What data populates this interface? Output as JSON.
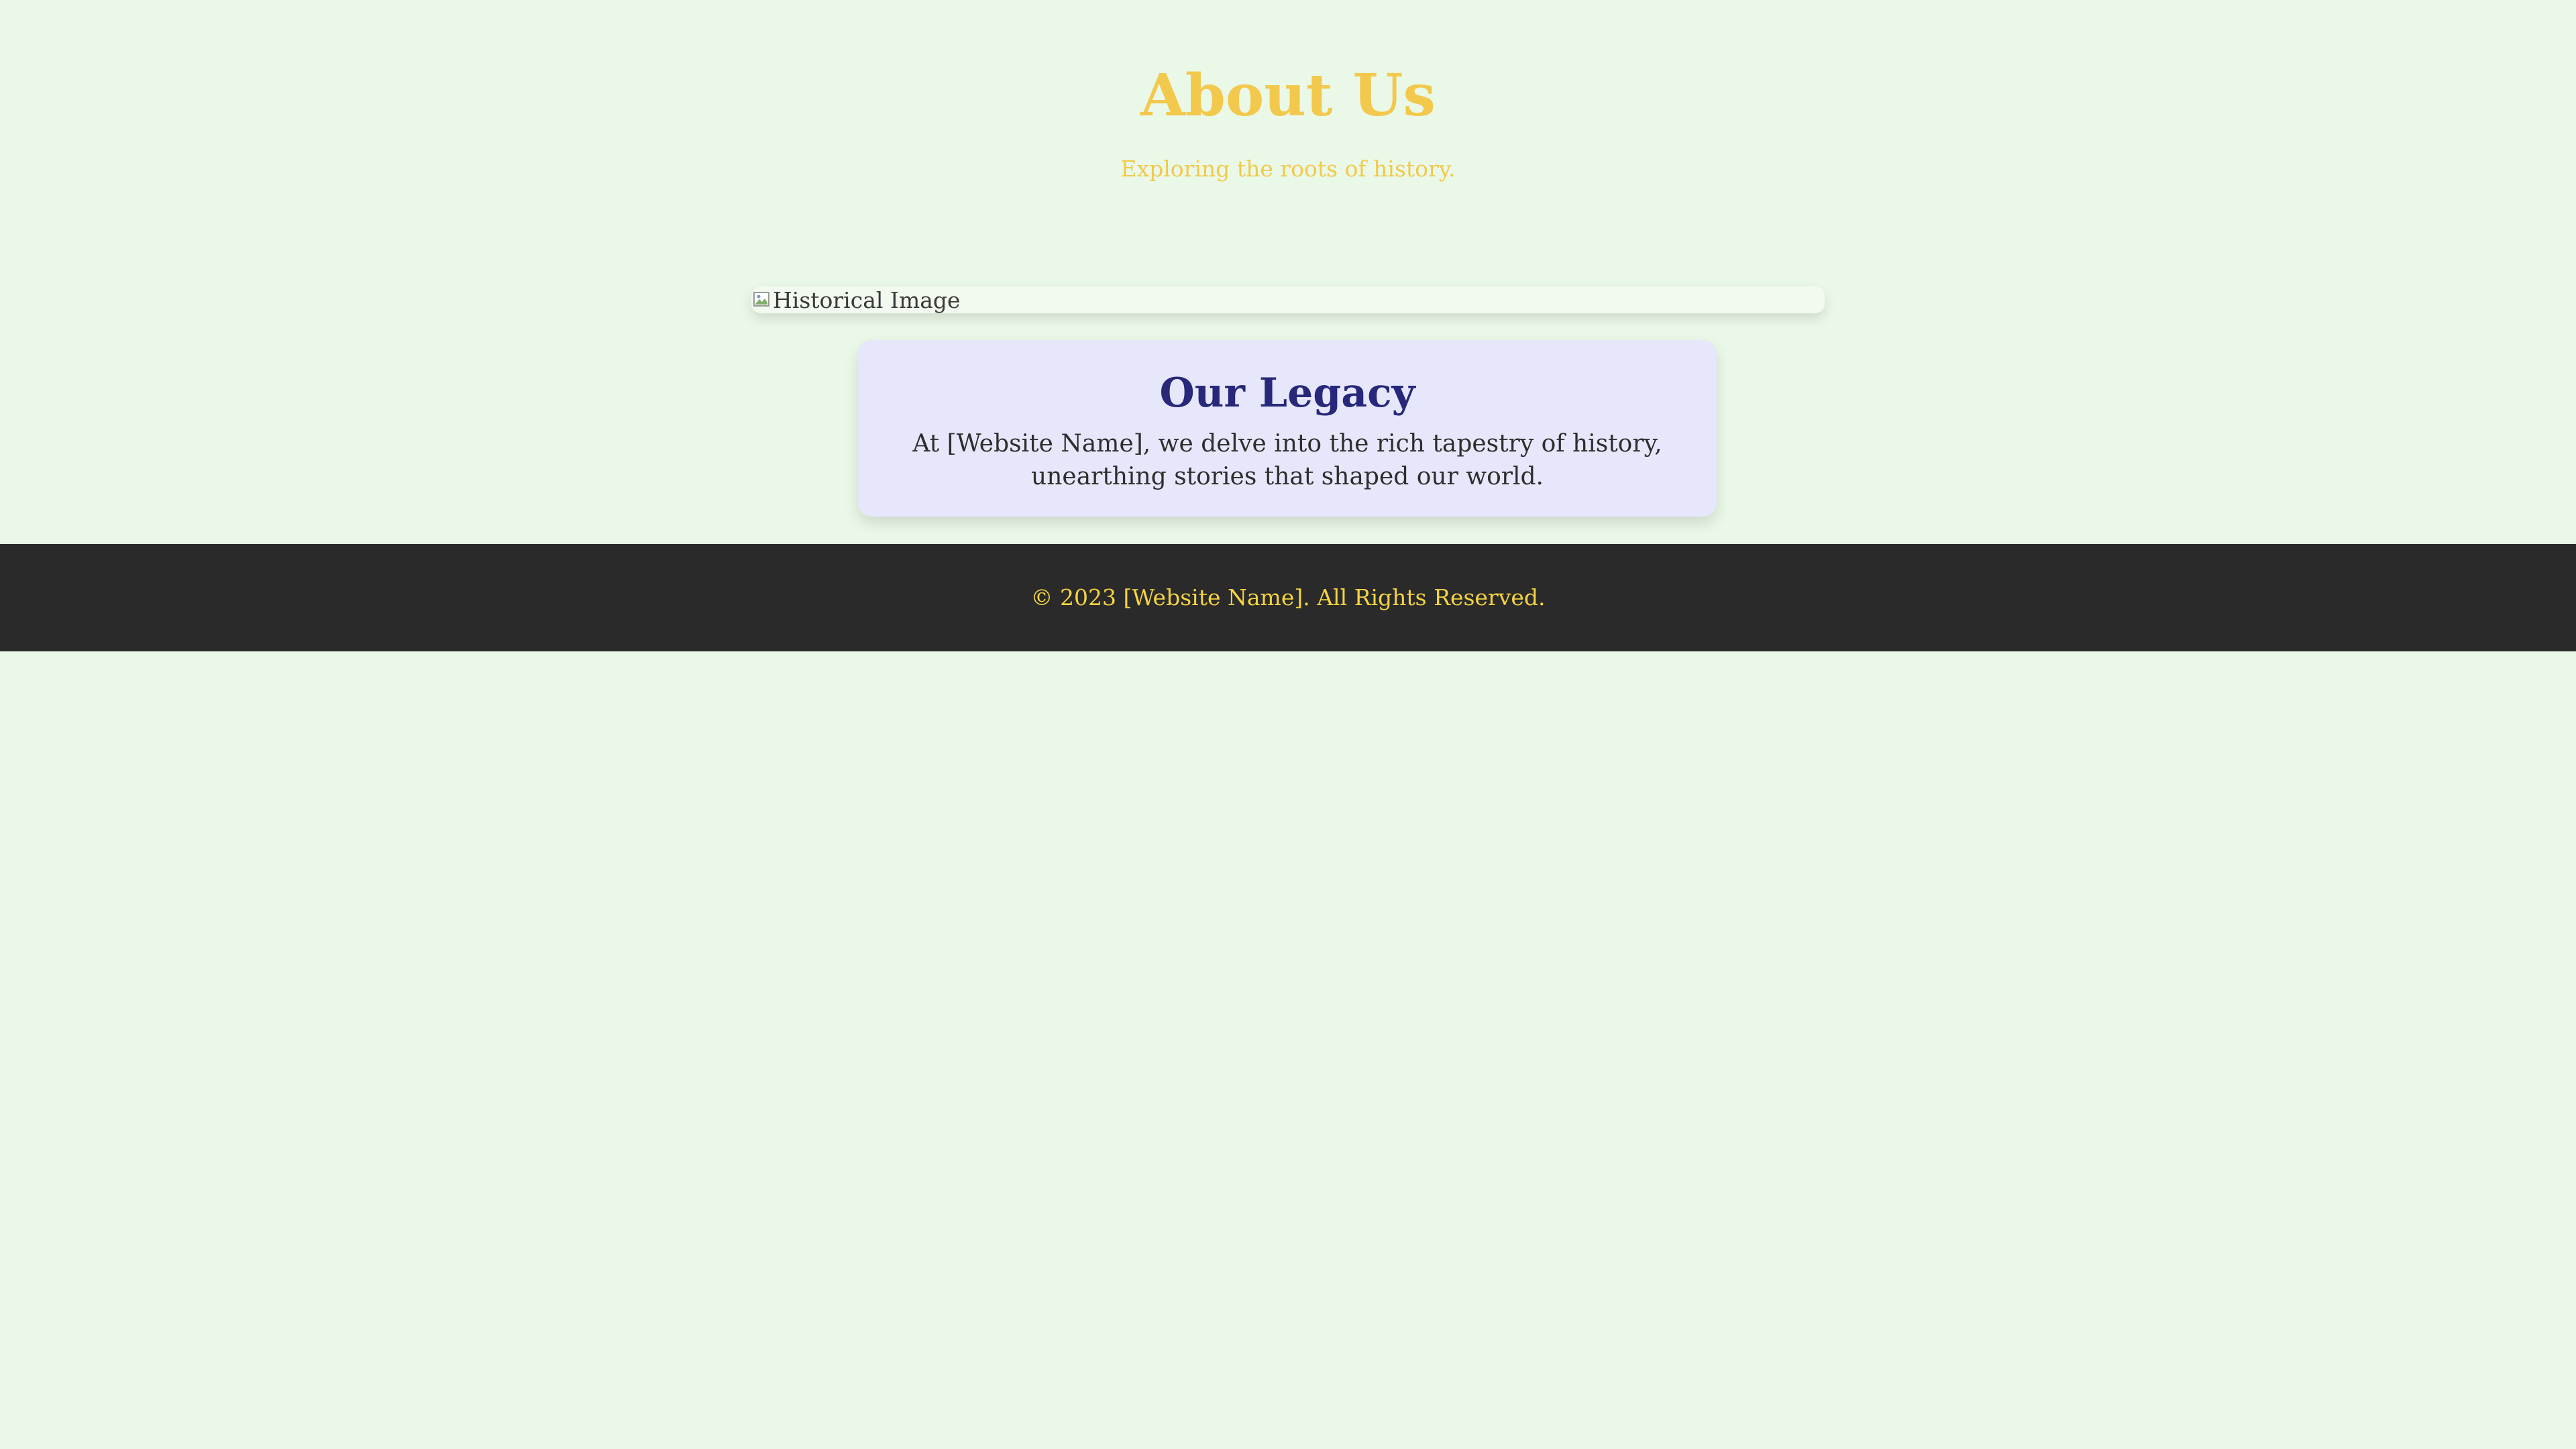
{
  "header": {
    "title": "About Us",
    "subtitle": "Exploring the roots of history."
  },
  "image": {
    "alt": "Historical Image",
    "icon": "broken-image-icon"
  },
  "legacy": {
    "heading": "Our Legacy",
    "body": "At [Website Name], we delve into the rich tapestry of history, unearthing stories that shaped our world."
  },
  "footer": {
    "copyright": "© 2023 [Website Name]. All Rights Reserved."
  },
  "colors": {
    "background": "#eaf8e7",
    "accent_gold": "#f2c94c",
    "card_background": "#e6e7fa",
    "card_heading": "#27287a",
    "footer_background": "#2a2a2a",
    "footer_text": "#f5d442"
  }
}
